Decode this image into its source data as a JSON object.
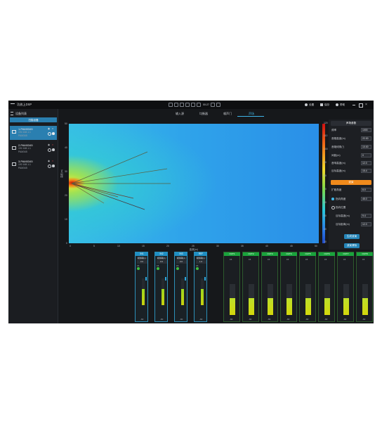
{
  "window": {
    "title": "功放上DSP",
    "toolbar_value": "00:27",
    "settings_label": "设置",
    "save_label": "保存",
    "help_label": "帮助"
  },
  "sidebar": {
    "title": "设备列表",
    "add_button": "扫描设备",
    "devices": [
      {
        "name": "1.PAM0345",
        "ip": "192.168.1.1",
        "type": "PAM345"
      },
      {
        "name": "2.PAM0345",
        "ip": "192.168.1.1",
        "type": "PAM345"
      },
      {
        "name": "3.PAM0345",
        "ip": "192.168.1.1",
        "type": "PAM345"
      }
    ]
  },
  "tabs": [
    {
      "label": "输入源",
      "active": false
    },
    {
      "label": "均衡器",
      "active": false
    },
    {
      "label": "噪声门",
      "active": false
    },
    {
      "label": "声场",
      "active": true
    }
  ],
  "plot": {
    "ylabel": "高度(m)",
    "xlabel": "距离(m)",
    "x_ticks": [
      "0",
      "5",
      "10",
      "15",
      "20",
      "25",
      "30",
      "35",
      "40",
      "45",
      "50"
    ],
    "y_ticks": [
      "50",
      "40",
      "30",
      "20",
      "10",
      "0"
    ],
    "colorbar_ticks": [
      "120",
      "110",
      "100",
      "90",
      "80",
      "70",
      "60",
      "50",
      "40",
      "30"
    ]
  },
  "right_panel": {
    "section1_title": "声场参数",
    "fields1": [
      {
        "label": "频率",
        "value": "1000"
      },
      {
        "label": "音箱高度(m)",
        "value": "22.00"
      },
      {
        "label": "音箱倾角(°)",
        "value": "10.00"
      },
      {
        "label": "间距(m)",
        "value": "0"
      },
      {
        "label": "音响高度(m)",
        "value": "12.0"
      },
      {
        "label": "目标高度(m)",
        "value": "15.4"
      }
    ],
    "section2_title": "波束",
    "fields2": [
      {
        "label": "扩散角度",
        "value": "8.0"
      },
      {
        "label": "指向角度",
        "value": "45.0",
        "radio": true,
        "checked": true
      },
      {
        "label": "指向位置",
        "value": "",
        "radio": true,
        "checked": false
      },
      {
        "label": "目标高度(m)",
        "value": "9.4"
      },
      {
        "label": "目标距离(m)",
        "value": "12.0"
      }
    ],
    "btn_primary": "生成波束",
    "btn_secondary": "波束清除"
  },
  "input_channels": [
    {
      "name": "IN1",
      "mode": "模拟输入",
      "value": "0.0",
      "scale_top": "15",
      "scale_bot": "-60",
      "level": 0.6
    },
    {
      "name": "IN2",
      "mode": "模拟输入",
      "value": "0.0",
      "scale_top": "15",
      "scale_bot": "-60",
      "level": 0.6
    },
    {
      "name": "IN3",
      "mode": "模拟输入",
      "value": "0.0",
      "scale_top": "15",
      "scale_bot": "-60",
      "level": 0.6
    },
    {
      "name": "REF",
      "mode": "模拟输入",
      "value": "1.0",
      "scale_top": "15",
      "scale_bot": "-60",
      "level": 0.6
    }
  ],
  "output_channels": [
    {
      "name": "OUT1",
      "scale_top": "15",
      "scale_bot": "-60",
      "level": 0.55
    },
    {
      "name": "OUT2",
      "scale_top": "15",
      "scale_bot": "-60",
      "level": 0.55
    },
    {
      "name": "OUT3",
      "scale_top": "15",
      "scale_bot": "-60",
      "level": 0.55
    },
    {
      "name": "OUT4",
      "scale_top": "15",
      "scale_bot": "-60",
      "level": 0.55
    },
    {
      "name": "OUT5",
      "scale_top": "15",
      "scale_bot": "-60",
      "level": 0.55
    },
    {
      "name": "OUT6",
      "scale_top": "15",
      "scale_bot": "-60",
      "level": 0.55
    },
    {
      "name": "OUT7",
      "scale_top": "15",
      "scale_bot": "-60",
      "level": 0.55
    },
    {
      "name": "OUT8",
      "scale_top": "15",
      "scale_bot": "-60",
      "level": 0.55
    }
  ],
  "colors": {
    "accent": "#3fb6e8",
    "orange": "#f08a1c",
    "green": "#1aa33c"
  }
}
